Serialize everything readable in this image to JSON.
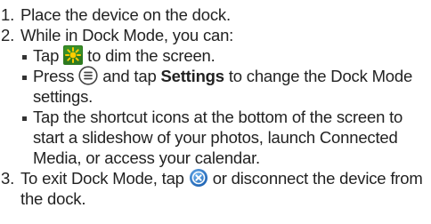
{
  "steps": [
    {
      "num": "1.",
      "text": "Place the device on the dock."
    },
    {
      "num": "2.",
      "text": "While in Dock Mode, you can:"
    },
    {
      "num": "3.",
      "before": "To exit Dock Mode, tap",
      "after": "or disconnect the device from the dock."
    }
  ],
  "bullets": [
    {
      "before": "Tap",
      "after": "to dim the screen.",
      "icon": "brightness-icon"
    },
    {
      "before": "Press",
      "middle": "and tap",
      "bold": "Settings",
      "after": "to change the Dock Mode settings.",
      "icon": "menu-key-icon"
    },
    {
      "text": "Tap the shortcut icons at the bottom of the screen to start a slideshow of your photos, launch Connected Media, or access your calendar."
    }
  ],
  "colors": {
    "text": "#222222",
    "brightness_bg": "#2e7a1f",
    "brightness_sun": "#ffcc00",
    "exit_icon_bg": "#2a7dd1"
  },
  "icons": {
    "exit": "exit-dock-icon"
  }
}
